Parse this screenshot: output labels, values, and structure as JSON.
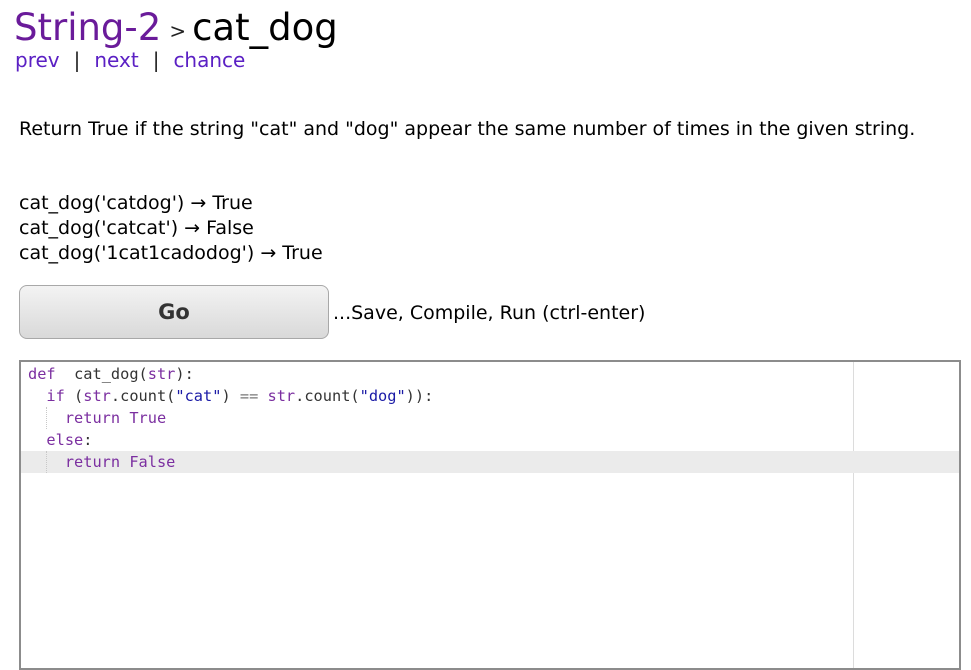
{
  "header": {
    "parent": "String-2",
    "separator": ">",
    "title": "cat_dog"
  },
  "nav": {
    "prev": "prev",
    "next": "next",
    "chance": "chance",
    "separator": "|"
  },
  "prompt": "Return True if the string \"cat\" and \"dog\" appear the same number of times in the given string.",
  "examples": [
    "cat_dog('catdog') → True",
    "cat_dog('catcat') → False",
    "cat_dog('1cat1cadodog') → True"
  ],
  "go": {
    "label": "Go",
    "hint": "...Save, Compile, Run (ctrl-enter)"
  },
  "editor": {
    "active_line": 4,
    "lines": [
      [
        [
          "kw",
          "def"
        ],
        [
          "",
          "  "
        ],
        [
          "",
          "cat_dog("
        ],
        [
          "kw",
          "str"
        ],
        [
          "",
          "):"
        ]
      ],
      [
        [
          "",
          "  "
        ],
        [
          "kw",
          "if"
        ],
        [
          "",
          " ("
        ],
        [
          "kw",
          "str"
        ],
        [
          "",
          ".count("
        ],
        [
          "str",
          "\"cat\""
        ],
        [
          "",
          ") "
        ],
        [
          "op",
          "=="
        ],
        [
          "",
          " "
        ],
        [
          "kw",
          "str"
        ],
        [
          "",
          ".count("
        ],
        [
          "str",
          "\"dog\""
        ],
        [
          "",
          "))"
        ],
        [
          "",
          ":"
        ]
      ],
      [
        [
          "",
          "    "
        ],
        [
          "kw",
          "return"
        ],
        [
          "",
          " "
        ],
        [
          "kw",
          "True"
        ]
      ],
      [
        [
          "",
          "  "
        ],
        [
          "kw",
          "else"
        ],
        [
          "",
          ":"
        ]
      ],
      [
        [
          "",
          "    "
        ],
        [
          "kw",
          "return"
        ],
        [
          "",
          " "
        ],
        [
          "kw",
          "False"
        ]
      ]
    ]
  }
}
